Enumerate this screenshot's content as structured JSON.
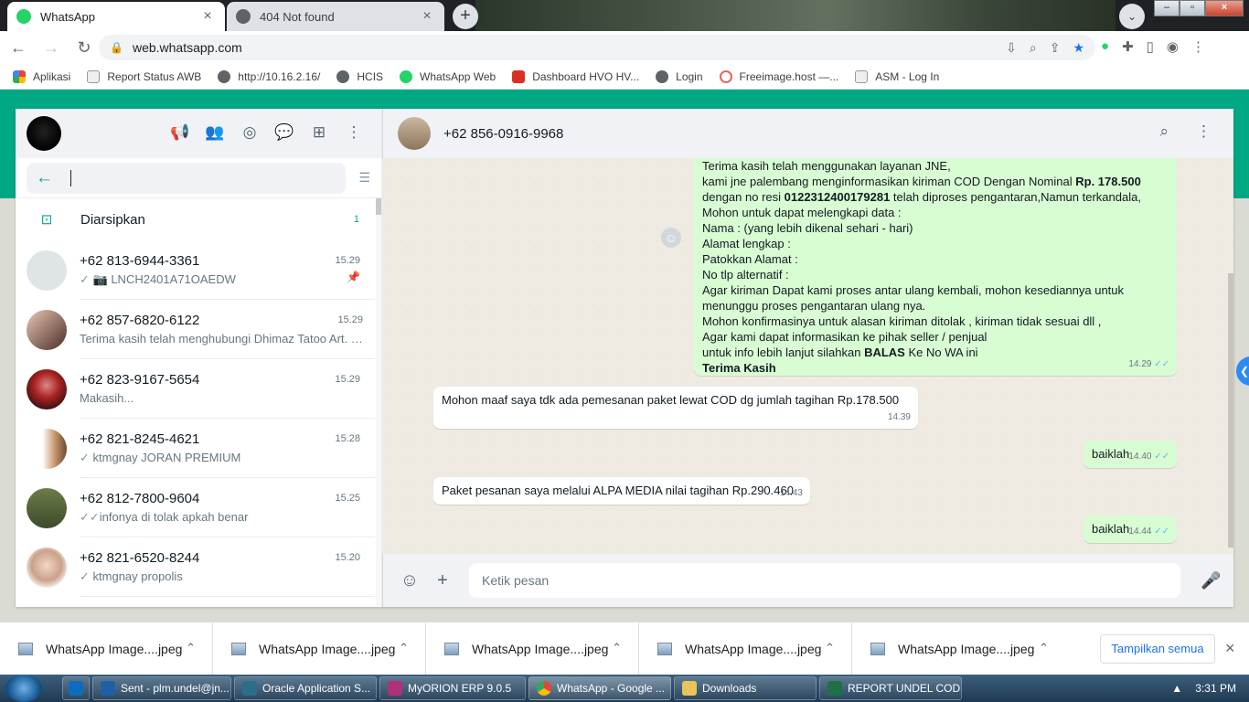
{
  "browser": {
    "tabs": [
      {
        "title": "WhatsApp",
        "active": true
      },
      {
        "title": "404 Not found",
        "active": false
      }
    ],
    "new_tab": "+",
    "url": "web.whatsapp.com",
    "bookmarks": [
      "Aplikasi",
      "Report Status AWB",
      "http://10.16.2.16/",
      "HCIS",
      "WhatsApp Web",
      "Dashboard HVO HV...",
      "Login",
      "Freeimage.host —...",
      "ASM - Log In"
    ]
  },
  "sidebar": {
    "search_placeholder": "",
    "archived": {
      "label": "Diarsipkan",
      "count": "1"
    },
    "chats": [
      {
        "name": "+62 813-6944-3361",
        "time": "15.29",
        "tick": "✓",
        "preview": "📷 LNCH2401A71OAEDW",
        "pinned": true
      },
      {
        "name": "+62 857-6820-6122",
        "time": "15.29",
        "tick": "",
        "preview": "Terima kasih telah menghubungi Dhimaz Tatoo Art. O..."
      },
      {
        "name": "+62 823-9167-5654",
        "time": "15.29",
        "tick": "",
        "preview": "Makasih..."
      },
      {
        "name": "+62 821-8245-4621",
        "time": "15.28",
        "tick": "✓",
        "preview": "ktmgnay JORAN PREMIUM"
      },
      {
        "name": "+62 812-7800-9604",
        "time": "15.25",
        "tick": "✓✓",
        "preview": "infonya di tolak apkah benar"
      },
      {
        "name": "+62 821-6520-8244",
        "time": "15.20",
        "tick": "✓",
        "preview": "ktmgnay propolis"
      }
    ]
  },
  "conversation": {
    "contact": "+62 856-0916-9968",
    "messages": {
      "m1": {
        "lines": [
          "Terima kasih telah menggunakan layanan JNE,",
          "kami jne palembang menginformasikan kiriman  COD Dengan Nominal ",
          "Rp. 178.500",
          "dengan no resi ",
          "0122312400179281",
          " telah diproses pengantaran,Namun terkandala,",
          "Mohon untuk dapat melengkapi data :",
          "Nama : (yang lebih dikenal sehari - hari)",
          "Alamat  lengkap :",
          "Patokkan Alamat :",
          "No tlp alternatif :",
          "Agar kiriman Dapat kami proses antar ulang kembali, mohon kesediannya untuk",
          "menunggu proses pengantaran ulang nya.",
          "Mohon konfirmasinya untuk alasan kiriman ditolak , kiriman tidak sesuai dll ,",
          " Agar kami dapat informasikan ke pihak seller / penjual",
          "untuk info lebih lanjut silahkan ",
          "BALAS",
          " Ke No WA ini",
          "Terima Kasih"
        ],
        "time": "14.29"
      },
      "m2": {
        "text": "Mohon maaf saya tdk ada pemesanan paket lewat COD dg jumlah tagihan Rp.178.500",
        "time": "14.39"
      },
      "m3": {
        "text": "baiklah",
        "time": "14.40"
      },
      "m4": {
        "text": "Paket pesanan saya melalui ALPA MEDIA nilai tagihan Rp.290.460",
        "time": "14.43"
      },
      "m5": {
        "text": "baiklah",
        "time": "14.44"
      }
    },
    "composer_placeholder": "Ketik pesan"
  },
  "downloads": {
    "items": [
      "WhatsApp Image....jpeg",
      "WhatsApp Image....jpeg",
      "WhatsApp Image....jpeg",
      "WhatsApp Image....jpeg",
      "WhatsApp Image....jpeg"
    ],
    "show_all": "Tampilkan semua"
  },
  "taskbar": {
    "tasks": [
      "Sent - plm.undel@jn...",
      "Oracle Application S...",
      "MyORION ERP 9.0.5",
      "WhatsApp - Google ...",
      "Downloads",
      "REPORT UNDEL COD..."
    ],
    "clock": "3:31 PM"
  },
  "colors": {
    "accent": "#00a884",
    "outgoing": "#d9fdd3",
    "read_tick": "#53bdeb"
  }
}
